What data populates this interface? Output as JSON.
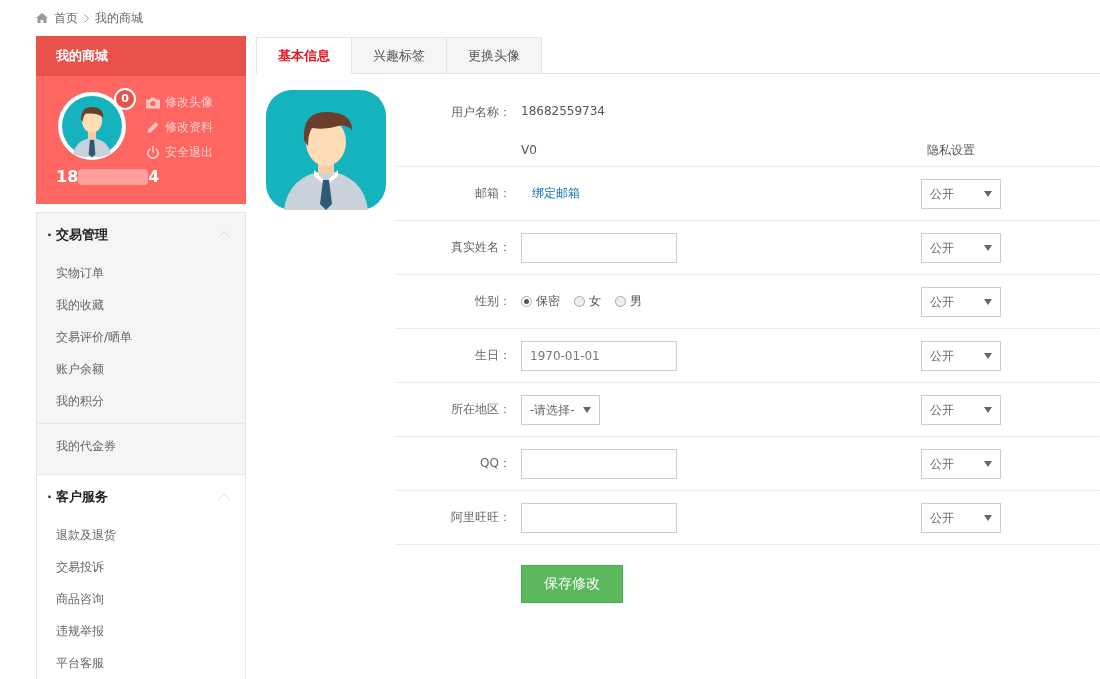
{
  "breadcrumb": [
    "首页",
    "我的商城"
  ],
  "sidebar": {
    "title": "我的商城",
    "badge": "0",
    "actions": [
      {
        "kind": "camera",
        "label": "修改头像"
      },
      {
        "kind": "pencil",
        "label": "修改资料"
      },
      {
        "kind": "power",
        "label": "安全退出"
      }
    ],
    "user_id_start": "18",
    "user_id_end": "4",
    "sections": [
      {
        "kind": "group",
        "title": "· 交易管理",
        "expanded": true,
        "items": [
          "实物订单",
          "我的收藏",
          "交易评价/晒单",
          "账户余额",
          "我的积分"
        ]
      },
      {
        "kind": "links",
        "items": [
          "我的代金券"
        ]
      },
      {
        "kind": "group",
        "title": "· 客户服务",
        "expanded": true,
        "items": [
          "退款及退货",
          "交易投诉",
          "商品咨询",
          "违规举报",
          "平台客服"
        ]
      }
    ]
  },
  "tabs": [
    {
      "label": "基本信息",
      "selected": true
    },
    {
      "label": "兴趣标签",
      "selected": false
    },
    {
      "label": "更换头像",
      "selected": false
    }
  ],
  "form": {
    "rows": [
      {
        "kind": "text",
        "label": "用户名称：",
        "value": "18682559734"
      },
      {
        "kind": "header",
        "value": "V0",
        "privacy_heading": "隐私设置"
      },
      {
        "kind": "link",
        "label": "邮箱：",
        "value": "绑定邮箱",
        "privacy": "公开"
      },
      {
        "kind": "input",
        "label": "真实姓名：",
        "privacy": "公开"
      },
      {
        "kind": "radio",
        "label": "性别：",
        "options": [
          {
            "label": "保密",
            "selected": true
          },
          {
            "label": "女",
            "selected": false
          },
          {
            "label": "男",
            "selected": false
          }
        ],
        "privacy": "公开"
      },
      {
        "kind": "input",
        "label": "生日：",
        "value": "1970-01-01",
        "privacy": "公开"
      },
      {
        "kind": "select",
        "label": "所在地区：",
        "value": "-请选择-",
        "privacy": "公开"
      },
      {
        "kind": "input",
        "label": "QQ：",
        "privacy": "公开"
      },
      {
        "kind": "input",
        "label": "阿里旺旺：",
        "privacy": "公开"
      }
    ],
    "save_button": "保存修改"
  }
}
